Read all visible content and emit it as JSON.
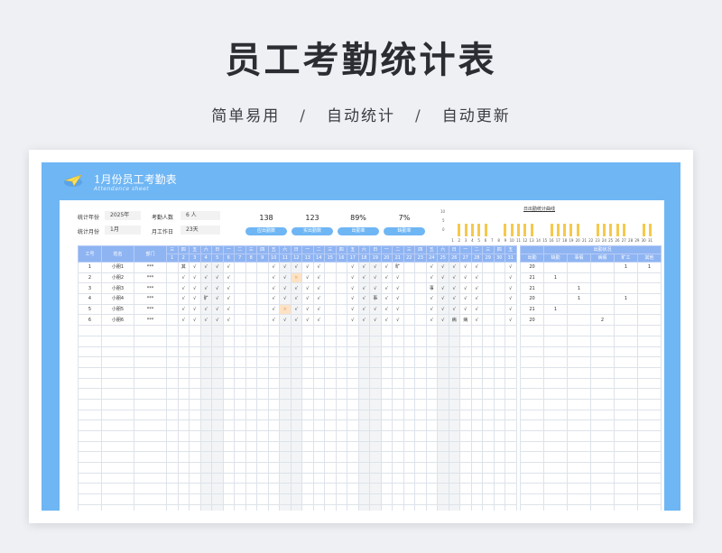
{
  "page": {
    "title": "员工考勤统计表",
    "features": [
      "简单易用",
      "自动统计",
      "自动更新"
    ],
    "separator": "/"
  },
  "sheet": {
    "title": "1月份员工考勤表",
    "subtitle": "Attendance sheet",
    "info": {
      "year_label": "统计年份",
      "year_value": "2025年",
      "count_label": "考勤人数",
      "count_value": "6  人",
      "month_label": "统计月份",
      "month_value": "1月",
      "workdays_label": "月工作日",
      "workdays_value": "23天"
    },
    "stats": [
      {
        "value": "138",
        "label": "应出勤数"
      },
      {
        "value": "123",
        "label": "实出勤数"
      },
      {
        "value": "89%",
        "label": "出勤率"
      },
      {
        "value": "7%",
        "label": "缺勤率"
      }
    ],
    "curve": {
      "title": "日出勤统计曲线",
      "axis_ticks": [
        "10",
        "5",
        "0"
      ],
      "days": [
        "1",
        "2",
        "3",
        "4",
        "5",
        "6",
        "7",
        "8",
        "9",
        "10",
        "11",
        "12",
        "13",
        "14",
        "15",
        "16",
        "17",
        "18",
        "19",
        "20",
        "21",
        "22",
        "23",
        "24",
        "25",
        "26",
        "27",
        "28",
        "29",
        "30",
        "31"
      ],
      "values": [
        0,
        6,
        6,
        6,
        6,
        6,
        0,
        0,
        6,
        6,
        6,
        6,
        6,
        0,
        0,
        6,
        6,
        6,
        6,
        6,
        0,
        0,
        6,
        6,
        6,
        6,
        6,
        0,
        0,
        6,
        6
      ]
    },
    "table": {
      "headers": {
        "no": "工号",
        "name": "姓名",
        "dept": "部门"
      },
      "weekdays": [
        "三",
        "四",
        "五",
        "六",
        "日",
        "一",
        "二",
        "三",
        "四",
        "五",
        "六",
        "日",
        "一",
        "二",
        "三",
        "四",
        "五",
        "六",
        "日",
        "一",
        "二",
        "三",
        "四",
        "五",
        "六",
        "日",
        "一",
        "二",
        "三",
        "四",
        "五"
      ],
      "days": [
        "1",
        "2",
        "3",
        "4",
        "5",
        "6",
        "7",
        "8",
        "9",
        "10",
        "11",
        "12",
        "13",
        "14",
        "15",
        "16",
        "17",
        "18",
        "19",
        "20",
        "21",
        "22",
        "23",
        "24",
        "25",
        "26",
        "27",
        "28",
        "29",
        "30",
        "31"
      ],
      "rows": [
        {
          "no": "1",
          "name": "小朋1",
          "dept": "***",
          "marks": [
            "",
            "其",
            "√",
            "√",
            "√",
            "√",
            "",
            "",
            "",
            "√",
            "√",
            "√",
            "√",
            "√",
            "",
            "",
            "√",
            "√",
            "√",
            "√",
            "旷",
            "",
            "",
            "√",
            "√",
            "√",
            "√",
            "√",
            "",
            "",
            "√",
            "√"
          ]
        },
        {
          "no": "2",
          "name": "小朋2",
          "dept": "***",
          "marks": [
            "",
            "√",
            "√",
            "√",
            "√",
            "√",
            "",
            "",
            "",
            "√",
            "√",
            "×",
            "√",
            "√",
            "",
            "",
            "√",
            "√",
            "√",
            "√",
            "√",
            "",
            "",
            "√",
            "√",
            "√",
            "√",
            "√",
            "",
            "",
            "√",
            "√"
          ]
        },
        {
          "no": "3",
          "name": "小朋3",
          "dept": "***",
          "marks": [
            "",
            "√",
            "√",
            "√",
            "√",
            "√",
            "",
            "",
            "",
            "√",
            "√",
            "√",
            "√",
            "√",
            "",
            "",
            "√",
            "√",
            "√",
            "√",
            "√",
            "",
            "",
            "事",
            "√",
            "√",
            "√",
            "√",
            "",
            "",
            "√",
            "√"
          ]
        },
        {
          "no": "4",
          "name": "小朋4",
          "dept": "***",
          "marks": [
            "",
            "√",
            "√",
            "旷",
            "√",
            "√",
            "",
            "",
            "",
            "√",
            "√",
            "√",
            "√",
            "√",
            "",
            "",
            "√",
            "√",
            "事",
            "√",
            "√",
            "",
            "",
            "√",
            "√",
            "√",
            "√",
            "√",
            "",
            "",
            "√",
            "√"
          ]
        },
        {
          "no": "5",
          "name": "小朋5",
          "dept": "***",
          "marks": [
            "",
            "√",
            "√",
            "√",
            "√",
            "√",
            "",
            "",
            "",
            "√",
            "×",
            "√",
            "√",
            "√",
            "",
            "",
            "√",
            "√",
            "√",
            "√",
            "√",
            "",
            "",
            "√",
            "√",
            "√",
            "√",
            "√",
            "",
            "",
            "√",
            "√"
          ]
        },
        {
          "no": "6",
          "name": "小朋6",
          "dept": "***",
          "marks": [
            "",
            "√",
            "√",
            "√",
            "√",
            "√",
            "",
            "",
            "",
            "√",
            "√",
            "√",
            "√",
            "√",
            "",
            "",
            "√",
            "√",
            "√",
            "√",
            "√",
            "",
            "",
            "√",
            "√",
            "病",
            "病",
            "√",
            "",
            "",
            "√",
            "√"
          ]
        }
      ]
    },
    "summary": {
      "group_header": "出勤状况",
      "columns": [
        "出勤",
        "缺勤",
        "事假",
        "病假",
        "旷工",
        "其他"
      ],
      "rows": [
        [
          "20",
          "",
          "",
          "",
          "1",
          "1"
        ],
        [
          "21",
          "1",
          "",
          "",
          "",
          ""
        ],
        [
          "21",
          "",
          "1",
          "",
          "",
          ""
        ],
        [
          "20",
          "",
          "1",
          "",
          "1",
          ""
        ],
        [
          "21",
          "1",
          "",
          "",
          "",
          ""
        ],
        [
          "20",
          "",
          "",
          "2",
          "",
          ""
        ]
      ]
    }
  }
}
